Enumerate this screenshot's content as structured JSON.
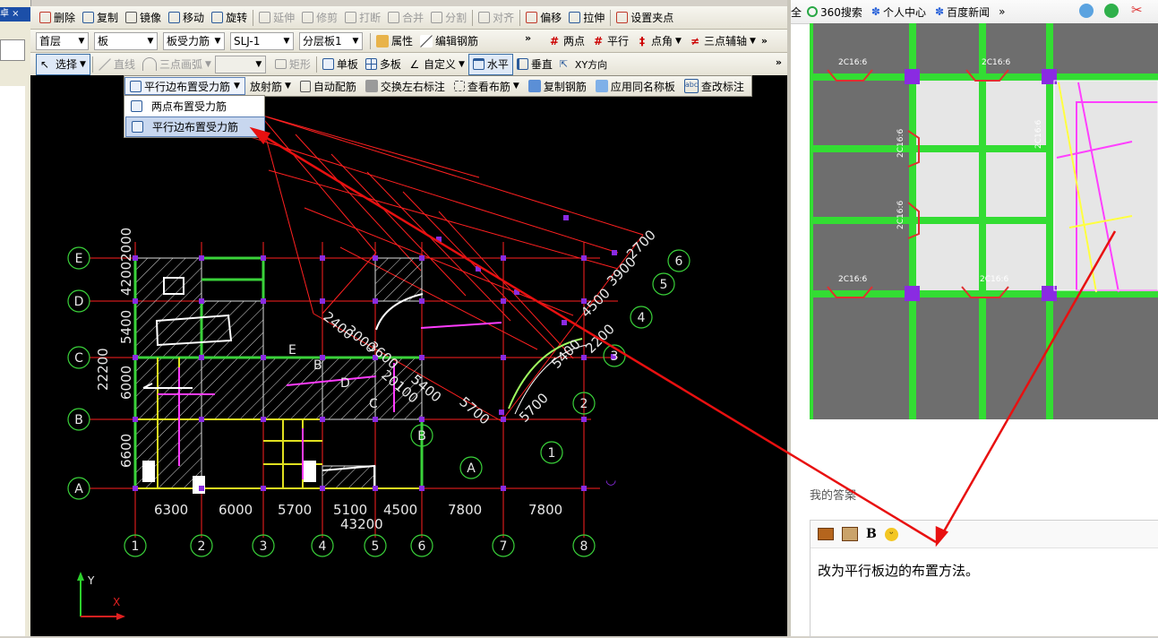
{
  "left_panel": {
    "caption": "卓 ×"
  },
  "toolbar1": {
    "items": [
      {
        "label": "删除",
        "icon": "pencil-delete-icon"
      },
      {
        "label": "复制",
        "icon": "copy-icon"
      },
      {
        "label": "镜像",
        "icon": "mirror-icon"
      },
      {
        "label": "移动",
        "icon": "move-icon"
      },
      {
        "label": "旋转",
        "icon": "rotate-icon"
      },
      {
        "label": "延伸",
        "icon": "extend-icon",
        "disabled": true
      },
      {
        "label": "修剪",
        "icon": "trim-icon",
        "disabled": true
      },
      {
        "label": "打断",
        "icon": "break-icon",
        "disabled": true
      },
      {
        "label": "合并",
        "icon": "merge-icon",
        "disabled": true
      },
      {
        "label": "分割",
        "icon": "split-icon",
        "disabled": true
      },
      {
        "label": "对齐",
        "icon": "align-icon",
        "disabled": true
      },
      {
        "label": "偏移",
        "icon": "offset-icon"
      },
      {
        "label": "拉伸",
        "icon": "stretch-icon"
      },
      {
        "label": "设置夹点",
        "icon": "grip-icon"
      }
    ]
  },
  "toolbar2": {
    "floor": "首层",
    "category": "板",
    "subtype": "板受力筋",
    "code": "SLJ-1",
    "layer": "分层板1",
    "property": "属性",
    "edit_rebar": "编辑钢筋",
    "right_items": [
      "两点",
      "平行",
      "点角",
      "三点辅轴"
    ]
  },
  "toolbar3": {
    "select": "选择",
    "line": "直线",
    "arc": "三点画弧",
    "rect": "矩形",
    "single": "单板",
    "multi": "多板",
    "custom": "自定义",
    "horizontal": "水平",
    "vertical": "垂直",
    "xy": "XY方向"
  },
  "floatbar": {
    "active": "平行边布置受力筋",
    "items": [
      "放射筋",
      "自动配筋",
      "交换左右标注",
      "查看布筋",
      "复制钢筋",
      "应用同名称板",
      "查改标注"
    ]
  },
  "dropdown": {
    "items": [
      "两点布置受力筋",
      "平行边布置受力筋"
    ],
    "highlighted": 1
  },
  "drawing": {
    "axis_rows": [
      "E",
      "D",
      "C",
      "B",
      "A"
    ],
    "axis_cols": [
      "1",
      "2",
      "3",
      "4",
      "5",
      "6",
      "7",
      "8"
    ],
    "row_dims": [
      "2000",
      "4200",
      "5400",
      "6000",
      "6600",
      "22200"
    ],
    "col_dims": [
      "6300",
      "6000",
      "5700",
      "5100",
      "4500",
      "7800",
      "7800"
    ],
    "total_width": "43200",
    "rotated_labels": [
      "6",
      "5",
      "4",
      "3",
      "2",
      "1"
    ],
    "rotated_dims": [
      "2700",
      "3900",
      "4500",
      "2200",
      "5400",
      "5700",
      "5700",
      "2400",
      "3000",
      "3600",
      "20100",
      "5400"
    ],
    "rotated_axis_letters": [
      "E",
      "B",
      "D",
      "C",
      "B",
      "A"
    ],
    "coord_y": "Y",
    "coord_x": "X"
  },
  "browser": {
    "bookmarks": [
      "全",
      "360搜索",
      "个人中心",
      "百度新闻",
      "»"
    ],
    "image_labels": [
      "2C16:6",
      "2C16:6",
      "2C16:6",
      "2C16:6",
      "2C16:6",
      "2C16:6",
      "2C16:6"
    ],
    "answer_label": "我的答案",
    "answer_text": "改为平行板边的布置方法。",
    "editor_tools": [
      "image-icon",
      "multi-image-icon",
      "B",
      "emoji-icon"
    ]
  }
}
